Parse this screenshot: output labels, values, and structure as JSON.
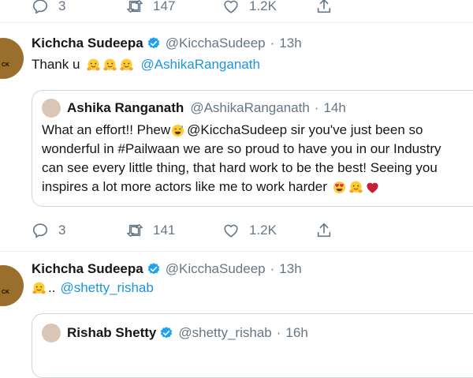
{
  "top_actions": {
    "reply_count": "3",
    "retweet_count": "147",
    "like_count": "1.2K"
  },
  "tweet1": {
    "name": "Kichcha Sudeepa",
    "handle": "@KicchaSudeep",
    "time": "13h",
    "text": "Thank u",
    "mention": "@AshikaRanganath",
    "avatar_text": "CK",
    "quote": {
      "name": "Ashika Ranganath",
      "handle": "@AshikaRanganath",
      "time": "14h",
      "line1_a": "What an effort!! Phew",
      "line1_b": " @KicchaSudeep sir you've just been so",
      "line2": "wonderful in #Pailwaan we are so proud to have you in our Industry",
      "line3": "can see every little thing, that hard work to be the best! Seeing you",
      "line4": "inspires a lot more actors like me to work harder"
    },
    "actions": {
      "reply_count": "3",
      "retweet_count": "141",
      "like_count": "1.2K"
    }
  },
  "tweet2": {
    "name": "Kichcha Sudeepa",
    "handle": "@KicchaSudeep",
    "time": "13h",
    "text": "..",
    "mention": "@shetty_rishab",
    "avatar_text": "CK",
    "quote": {
      "name": "Rishab Shetty",
      "handle": "@shetty_rishab",
      "time": "16h"
    }
  },
  "colors": {
    "link": "#1b95e0",
    "muted": "#657786",
    "verified": "#1da1f2",
    "border": "#ccd6dd"
  },
  "icons": [
    "reply-icon",
    "retweet-icon",
    "like-icon",
    "share-icon",
    "verified-badge-icon",
    "hugging-face-emoji",
    "sweat-smile-emoji",
    "heart-eyes-emoji",
    "red-heart-emoji"
  ]
}
